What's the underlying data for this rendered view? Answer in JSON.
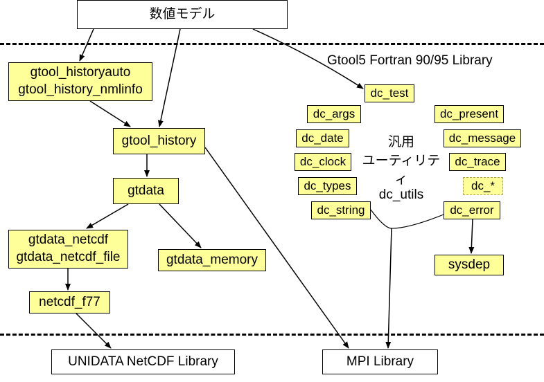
{
  "top_box": "数値モデル",
  "library_label": "Gtool5 Fortran 90/95 Library",
  "gtool_historyauto_line1": "gtool_historyauto",
  "gtool_historyauto_line2": "gtool_history_nmlinfo",
  "gtool_history": "gtool_history",
  "gtdata": "gtdata",
  "gtdata_netcdf_line1": "gtdata_netcdf",
  "gtdata_netcdf_line2": "gtdata_netcdf_file",
  "gtdata_memory": "gtdata_memory",
  "netcdf_f77": "netcdf_f77",
  "unidata": "UNIDATA NetCDF Library",
  "mpi": "MPI Library",
  "dc_test": "dc_test",
  "dc_args": "dc_args",
  "dc_present": "dc_present",
  "dc_date": "dc_date",
  "dc_message": "dc_message",
  "dc_clock": "dc_clock",
  "dc_trace": "dc_trace",
  "dc_types": "dc_types",
  "dc_star": "dc_*",
  "dc_string": "dc_string",
  "dc_error": "dc_error",
  "sysdep": "sysdep",
  "utils_label_line1": "汎用",
  "utils_label_line2": "ユーティリティ",
  "utils_label_line3": "dc_utils"
}
